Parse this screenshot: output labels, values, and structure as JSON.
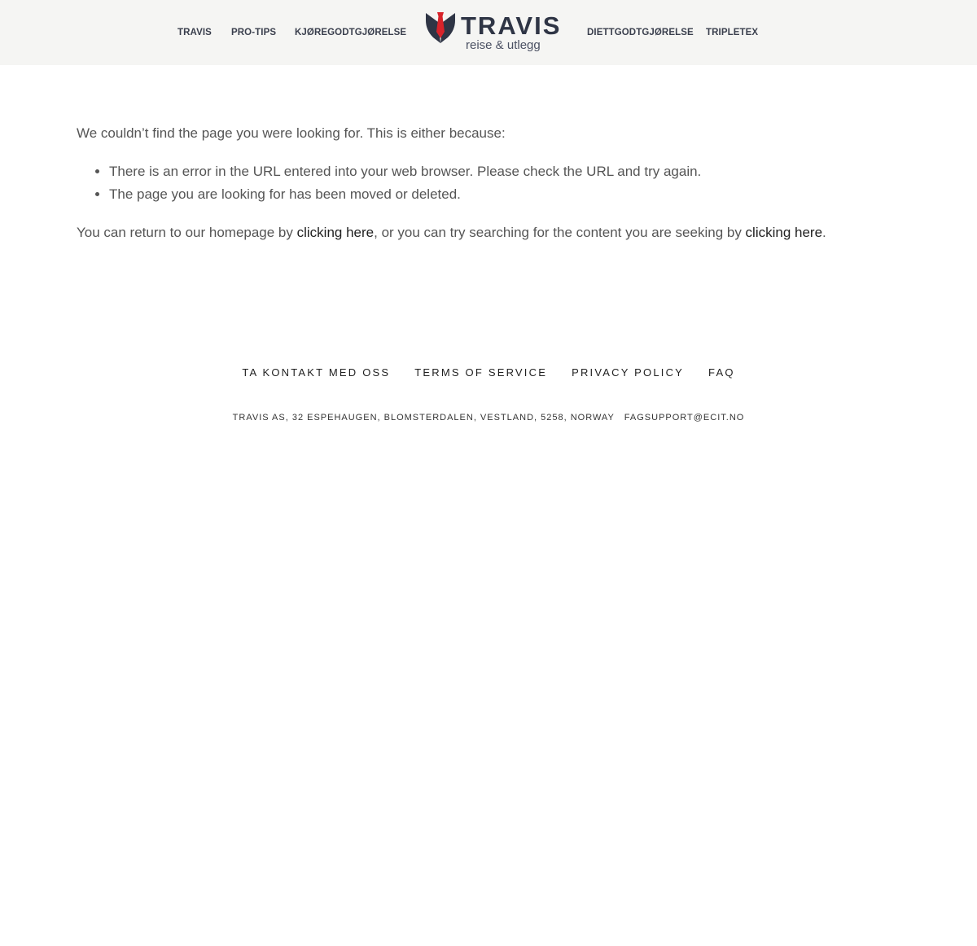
{
  "header": {
    "nav_left": [
      {
        "label": "TRAVIS"
      },
      {
        "label": "PRO-TIPS"
      },
      {
        "label": "KJØREGODTGJØRELSE"
      }
    ],
    "nav_right": [
      {
        "label": "DIETTGODTGJØRELSE"
      },
      {
        "label": "TRIPLETEX"
      }
    ],
    "logo": {
      "name": "TRAVIS",
      "tagline": "reise & utlegg",
      "icon": "tie-icon",
      "colors": {
        "navy": "#2f3545",
        "red": "#d8232a"
      }
    }
  },
  "main": {
    "intro": "We couldn’t find the page you were looking for. This is either because:",
    "reasons": [
      "There is an error in the URL entered into your web browser. Please check the URL and try again.",
      "The page you are looking for has been moved or deleted."
    ],
    "return_prefix": "You can return to our homepage by ",
    "homepage_link": "clicking here",
    "return_middle": ", or you can try searching for the content you are seeking by ",
    "search_link": "clicking here",
    "return_suffix": "."
  },
  "footer": {
    "links": [
      {
        "label": "TA KONTAKT MED OSS"
      },
      {
        "label": "TERMS OF SERVICE"
      },
      {
        "label": "PRIVACY POLICY"
      },
      {
        "label": "FAQ"
      }
    ],
    "address": "TRAVIS AS, 32 ESPEHAUGEN, BLOMSTERDALEN, VESTLAND, 5258, NORWAY",
    "email": "FAGSUPPORT@ECIT.NO"
  }
}
